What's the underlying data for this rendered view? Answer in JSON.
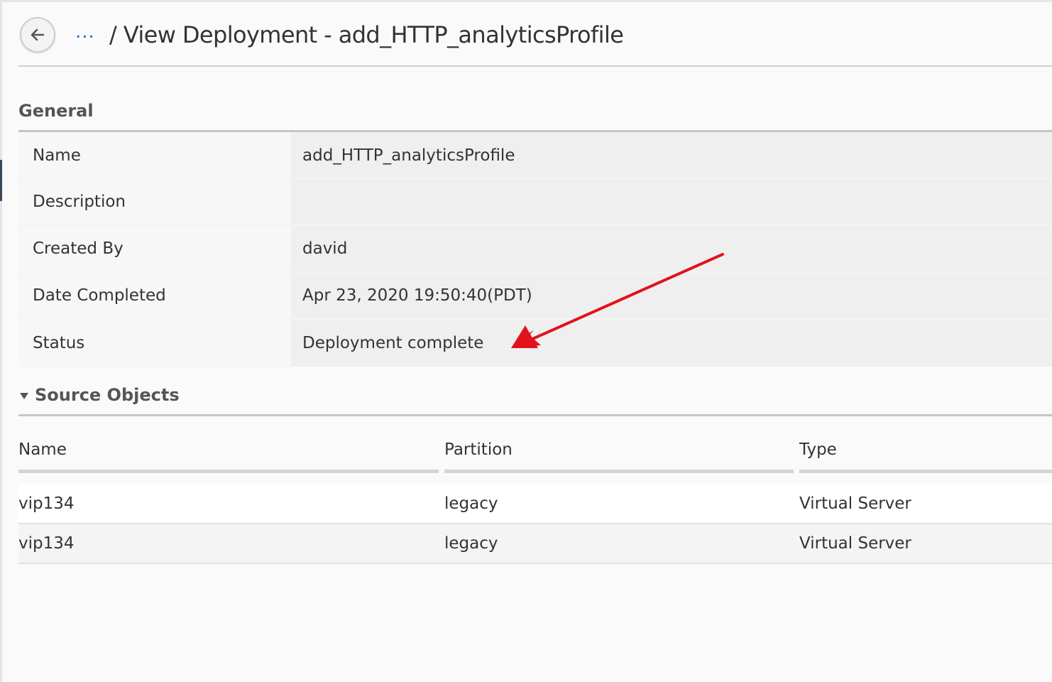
{
  "header": {
    "back_label": "Back",
    "breadcrumb_more": "...",
    "title": "/ View Deployment - add_HTTP_analyticsProfile"
  },
  "general": {
    "title": "General",
    "rows": [
      {
        "label": "Name",
        "value": "add_HTTP_analyticsProfile"
      },
      {
        "label": "Description",
        "value": ""
      },
      {
        "label": "Created By",
        "value": "david"
      },
      {
        "label": "Date Completed",
        "value": "Apr 23, 2020 19:50:40(PDT)"
      },
      {
        "label": "Status",
        "value": "Deployment complete"
      }
    ]
  },
  "source_objects": {
    "title": "Source Objects",
    "columns": [
      "Name",
      "Partition",
      "Type"
    ],
    "rows": [
      [
        "vip134",
        "legacy",
        "Virtual Server"
      ],
      [
        "vip134",
        "legacy",
        "Virtual Server"
      ]
    ]
  },
  "colors": {
    "link": "#2067c8",
    "annotation_arrow": "#e0131b",
    "section_rule": "#c6c6c6"
  },
  "icons": {
    "back": "arrow-left-icon",
    "collapse": "triangle-down-icon",
    "annotation": "red-arrow-icon"
  }
}
